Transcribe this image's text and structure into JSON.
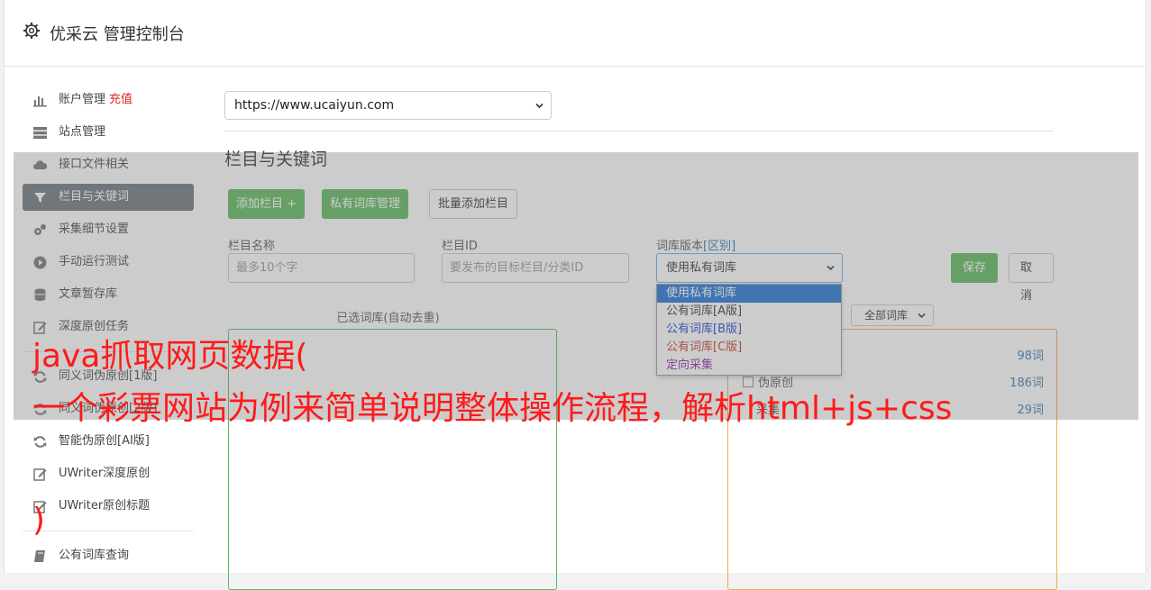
{
  "header": {
    "title": "优采云 管理控制台"
  },
  "sidebar": {
    "items": [
      {
        "label": "账户管理",
        "extra": "充值",
        "icon": "bar-chart-icon"
      },
      {
        "label": "站点管理",
        "icon": "server-icon"
      },
      {
        "label": "接口文件相关",
        "icon": "cloud-upload-icon"
      },
      {
        "label": "栏目与关键词",
        "icon": "filter-icon",
        "active": true
      },
      {
        "label": "采集细节设置",
        "icon": "cogs-icon"
      },
      {
        "label": "手动运行测试",
        "icon": "play-circle-icon"
      },
      {
        "label": "文章暂存库",
        "icon": "database-icon"
      },
      {
        "label": "深度原创任务",
        "icon": "edit-icon"
      }
    ],
    "items2": [
      {
        "label": "同义词伪原创[1版]",
        "icon": "refresh-icon"
      },
      {
        "label": "同义词伪原创[2版]",
        "icon": "refresh-icon"
      },
      {
        "label": "智能伪原创[AI版]",
        "icon": "refresh-icon"
      },
      {
        "label": "UWriter深度原创",
        "icon": "edit-icon"
      },
      {
        "label": "UWriter原创标题",
        "icon": "edit-icon"
      }
    ],
    "items3": [
      {
        "label": "公有词库查询",
        "icon": "book-icon"
      }
    ]
  },
  "main": {
    "site_select": "https://www.ucaiyun.com",
    "section_title": "栏目与关键词",
    "buttons": {
      "add": "添加栏目 +",
      "private": "私有词库管理",
      "batch": "批量添加栏目",
      "save": "保存",
      "cancel": "取消"
    },
    "form": {
      "name_label": "栏目名称",
      "name_placeholder": "最多10个字",
      "id_label": "栏目ID",
      "id_placeholder": "要发布的目标栏目/分类ID",
      "lib_label": "词库版本",
      "lib_label_link": "[区别]",
      "lib_value": "使用私有词库",
      "options": [
        "使用私有词库",
        "公有词库[A版]",
        "公有词库[B版]",
        "公有词库[C版]",
        "定向采集"
      ]
    },
    "selected_title": "已选词库(自动去重)",
    "filter_value": "全部词库",
    "libs": [
      {
        "name": "",
        "count": "98词"
      },
      {
        "name": "伪原创",
        "count": "186词"
      },
      {
        "name": "采集",
        "count": "29词"
      }
    ]
  },
  "colors": {
    "green": "#5cb85c",
    "orange": "#f0ad4e",
    "link": "#337ab7",
    "red": "#ff1a1a"
  },
  "banner": {
    "line1": "java抓取网页数据(",
    "line2": "一个彩票网站为例来简单说明整体操作流程，解析html+js+css",
    "line3": ")"
  }
}
